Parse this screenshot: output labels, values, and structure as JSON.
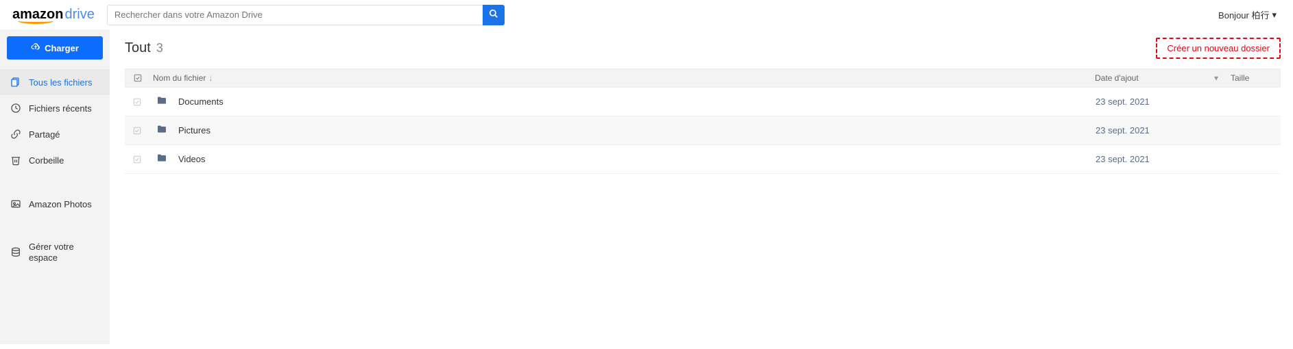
{
  "header": {
    "logo_amazon": "amazon",
    "logo_drive": "drive",
    "search_placeholder": "Rechercher dans votre Amazon Drive",
    "greeting": "Bonjour 柏行"
  },
  "sidebar": {
    "upload_label": "Charger",
    "items": [
      {
        "label": "Tous les fichiers",
        "icon": "files-icon",
        "active": true
      },
      {
        "label": "Fichiers récents",
        "icon": "clock-icon",
        "active": false
      },
      {
        "label": "Partagé",
        "icon": "share-icon",
        "active": false
      },
      {
        "label": "Corbeille",
        "icon": "trash-icon",
        "active": false
      },
      {
        "label": "Amazon Photos",
        "icon": "photos-icon",
        "active": false
      },
      {
        "label": "Gérer votre espace",
        "icon": "storage-icon",
        "active": false
      }
    ]
  },
  "main": {
    "title": "Tout",
    "count": "3",
    "create_folder_label": "Créer un nouveau dossier",
    "columns": {
      "name": "Nom du fichier",
      "date": "Date d'ajout",
      "size": "Taille"
    },
    "rows": [
      {
        "name": "Documents",
        "date": "23 sept. 2021",
        "size": ""
      },
      {
        "name": "Pictures",
        "date": "23 sept. 2021",
        "size": ""
      },
      {
        "name": "Videos",
        "date": "23 sept. 2021",
        "size": ""
      }
    ]
  }
}
